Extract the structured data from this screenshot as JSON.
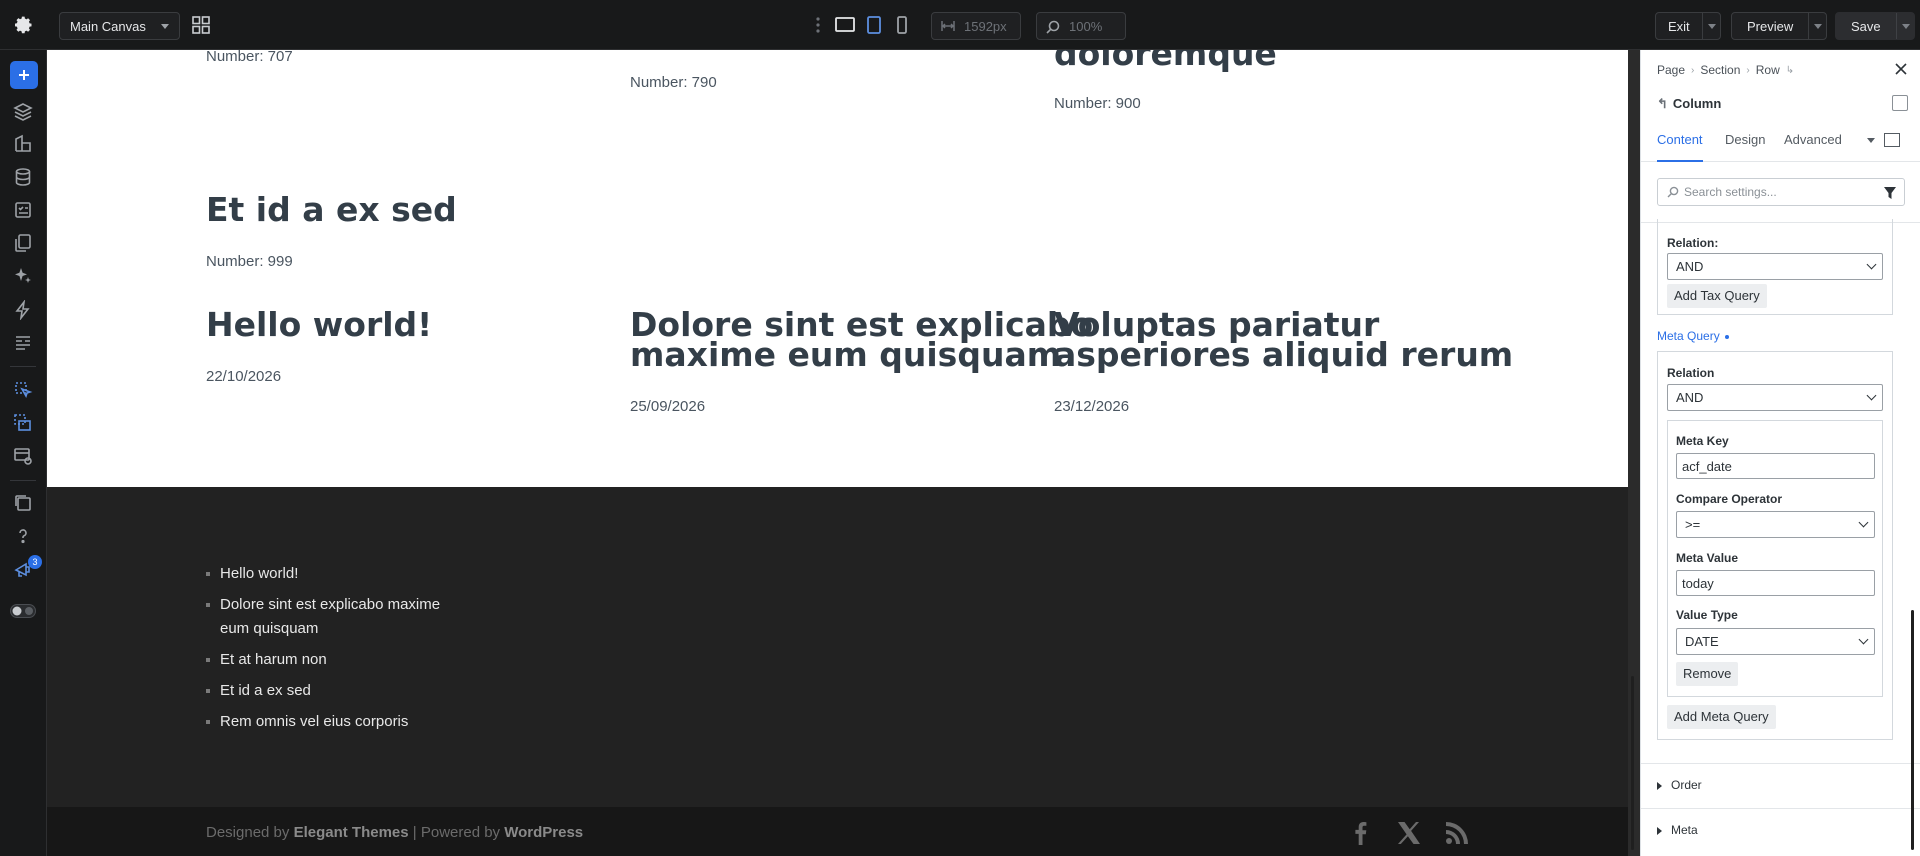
{
  "topbar": {
    "canvas_select": "Main Canvas",
    "width_value": "1592px",
    "zoom_value": "100%",
    "exit_label": "Exit",
    "preview_label": "Preview",
    "save_label": "Save"
  },
  "rail": {
    "notification_count": "3"
  },
  "content": {
    "top_row": [
      {
        "meta": "Number: 707"
      },
      {
        "meta": "Number: 790"
      },
      {
        "title": "doloremque",
        "meta": "Number: 900"
      }
    ],
    "middle_post": {
      "title": "Et id a ex sed",
      "meta": "Number: 999"
    },
    "posts": [
      {
        "title_lines": [
          "Hello world!"
        ],
        "date": "22/10/2026"
      },
      {
        "title_lines": [
          "Dolore sint est explicabo",
          "maxime eum quisquam"
        ],
        "date": "25/09/2026"
      },
      {
        "title_lines": [
          "Voluptas pariatur",
          "asperiores aliquid rerum"
        ],
        "date": "23/12/2026"
      }
    ]
  },
  "footer": {
    "links": [
      [
        "Hello world!"
      ],
      [
        "Dolore sint est explicabo maxime",
        "eum quisquam"
      ],
      [
        "Et at harum non"
      ],
      [
        "Et id a ex sed"
      ],
      [
        "Rem omnis vel eius corporis"
      ]
    ],
    "credit_designed": "Designed by",
    "credit_theme": "Elegant Themes",
    "credit_sep": "| Powered by",
    "credit_wp": "WordPress"
  },
  "panel": {
    "breadcrumbs": [
      "Page",
      "Section",
      "Row"
    ],
    "module_title": "Column",
    "tabs": [
      "Content",
      "Design",
      "Advanced"
    ],
    "active_tab": "Content",
    "search_placeholder": "Search settings...",
    "tax": {
      "relation_label": "Relation:",
      "relation_value": "AND",
      "add_button": "Add Tax Query"
    },
    "meta_query": {
      "section_title": "Meta Query",
      "relation_label": "Relation",
      "relation_value": "AND",
      "meta_key_label": "Meta Key",
      "meta_key_value": "acf_date",
      "compare_label": "Compare Operator",
      "compare_value": ">=",
      "meta_value_label": "Meta Value",
      "meta_value_value": "today",
      "value_type_label": "Value Type",
      "value_type_value": "DATE",
      "remove_button": "Remove",
      "add_button": "Add Meta Query"
    },
    "accordions": [
      "Order",
      "Meta"
    ]
  }
}
